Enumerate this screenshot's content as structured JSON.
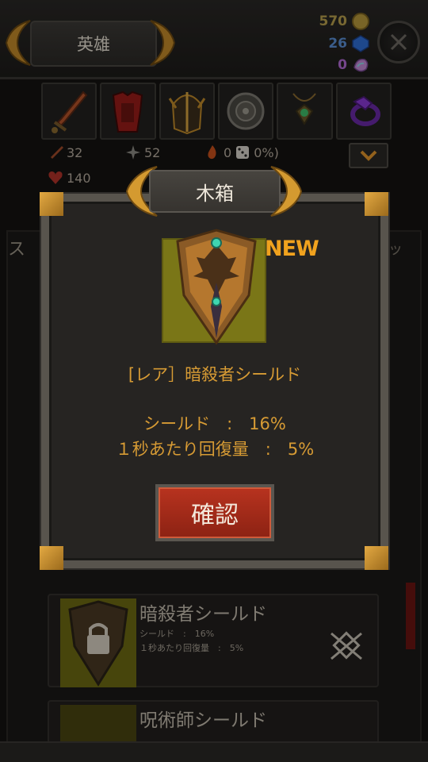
{
  "header": {
    "title": "英雄",
    "currencies": [
      {
        "name": "gold",
        "value": "570",
        "color": "#b9a04e"
      },
      {
        "name": "gem",
        "value": "26",
        "color": "#5b8fd6"
      },
      {
        "name": "crystal",
        "value": "0",
        "color": "#b46cd8"
      }
    ],
    "close_icon": "close-icon"
  },
  "equipment": {
    "slots": [
      "sword-icon",
      "armor-icon",
      "helmet-icon",
      "round-shield-icon",
      "amulet-icon",
      "ring-icon"
    ],
    "stats": {
      "attack": "32",
      "crit": "52",
      "fire": "0",
      "luck": "0%)",
      "hp": "140"
    }
  },
  "background": {
    "tab_fragment": "ス",
    "tab_fragment_right": "ッ",
    "items": [
      {
        "name": "暗殺者シールド",
        "stat1": "シールド　:　16%",
        "stat2": "１秒あたり回復量　:　5%"
      },
      {
        "name": "呪術師シールド"
      }
    ]
  },
  "modal": {
    "title": "木箱",
    "new_label": "NEW",
    "item_name": "[レア］暗殺者シールド",
    "stat_shield": "シールド　:　16%",
    "stat_regen": "１秒あたり回復量　:　5%",
    "confirm_label": "確認"
  },
  "colors": {
    "accent_gold": "#d79b34",
    "confirm_red": "#b8331f",
    "new_orange": "#f0a21e"
  }
}
